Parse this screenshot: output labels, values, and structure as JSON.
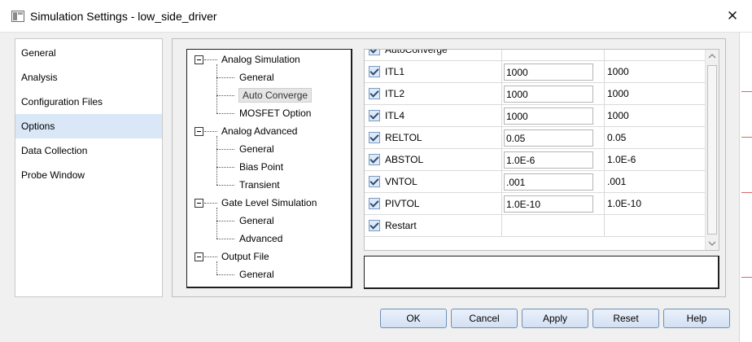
{
  "window": {
    "title": "Simulation Settings - low_side_driver",
    "close_glyph": "✕"
  },
  "sidebar": {
    "items": [
      {
        "label": "General",
        "selected": false
      },
      {
        "label": "Analysis",
        "selected": false
      },
      {
        "label": "Configuration Files",
        "selected": false
      },
      {
        "label": "Options",
        "selected": true
      },
      {
        "label": "Data Collection",
        "selected": false
      },
      {
        "label": "Probe Window",
        "selected": false
      }
    ]
  },
  "tree": {
    "groups": [
      {
        "label": "Analog Simulation",
        "expanded": true,
        "children": [
          "General",
          "Auto Converge",
          "MOSFET Option"
        ]
      },
      {
        "label": "Analog Advanced",
        "expanded": true,
        "children": [
          "General",
          "Bias Point",
          "Transient"
        ]
      },
      {
        "label": "Gate Level Simulation",
        "expanded": true,
        "children": [
          "General",
          "Advanced"
        ]
      },
      {
        "label": "Output File",
        "expanded": true,
        "children": [
          "General"
        ]
      }
    ],
    "selected_child": "Auto Converge"
  },
  "grid": {
    "rows": [
      {
        "name": "AutoConverge",
        "checked": true,
        "value": "",
        "default": ""
      },
      {
        "name": "ITL1",
        "checked": true,
        "value": "1000",
        "default": "1000"
      },
      {
        "name": "ITL2",
        "checked": true,
        "value": "1000",
        "default": "1000"
      },
      {
        "name": "ITL4",
        "checked": true,
        "value": "1000",
        "default": "1000"
      },
      {
        "name": "RELTOL",
        "checked": true,
        "value": "0.05",
        "default": "0.05"
      },
      {
        "name": "ABSTOL",
        "checked": true,
        "value": "1.0E-6",
        "default": "1.0E-6"
      },
      {
        "name": "VNTOL",
        "checked": true,
        "value": ".001",
        "default": ".001"
      },
      {
        "name": "PIVTOL",
        "checked": true,
        "value": "1.0E-10",
        "default": "1.0E-10"
      },
      {
        "name": "Restart",
        "checked": true,
        "value": "",
        "default": ""
      }
    ]
  },
  "description": "",
  "buttons": {
    "ok": "OK",
    "cancel": "Cancel",
    "apply": "Apply",
    "reset": "Reset",
    "help": "Help"
  },
  "colors": {
    "selection": "#d9e7f6",
    "button_border": "#6f8fb8"
  }
}
